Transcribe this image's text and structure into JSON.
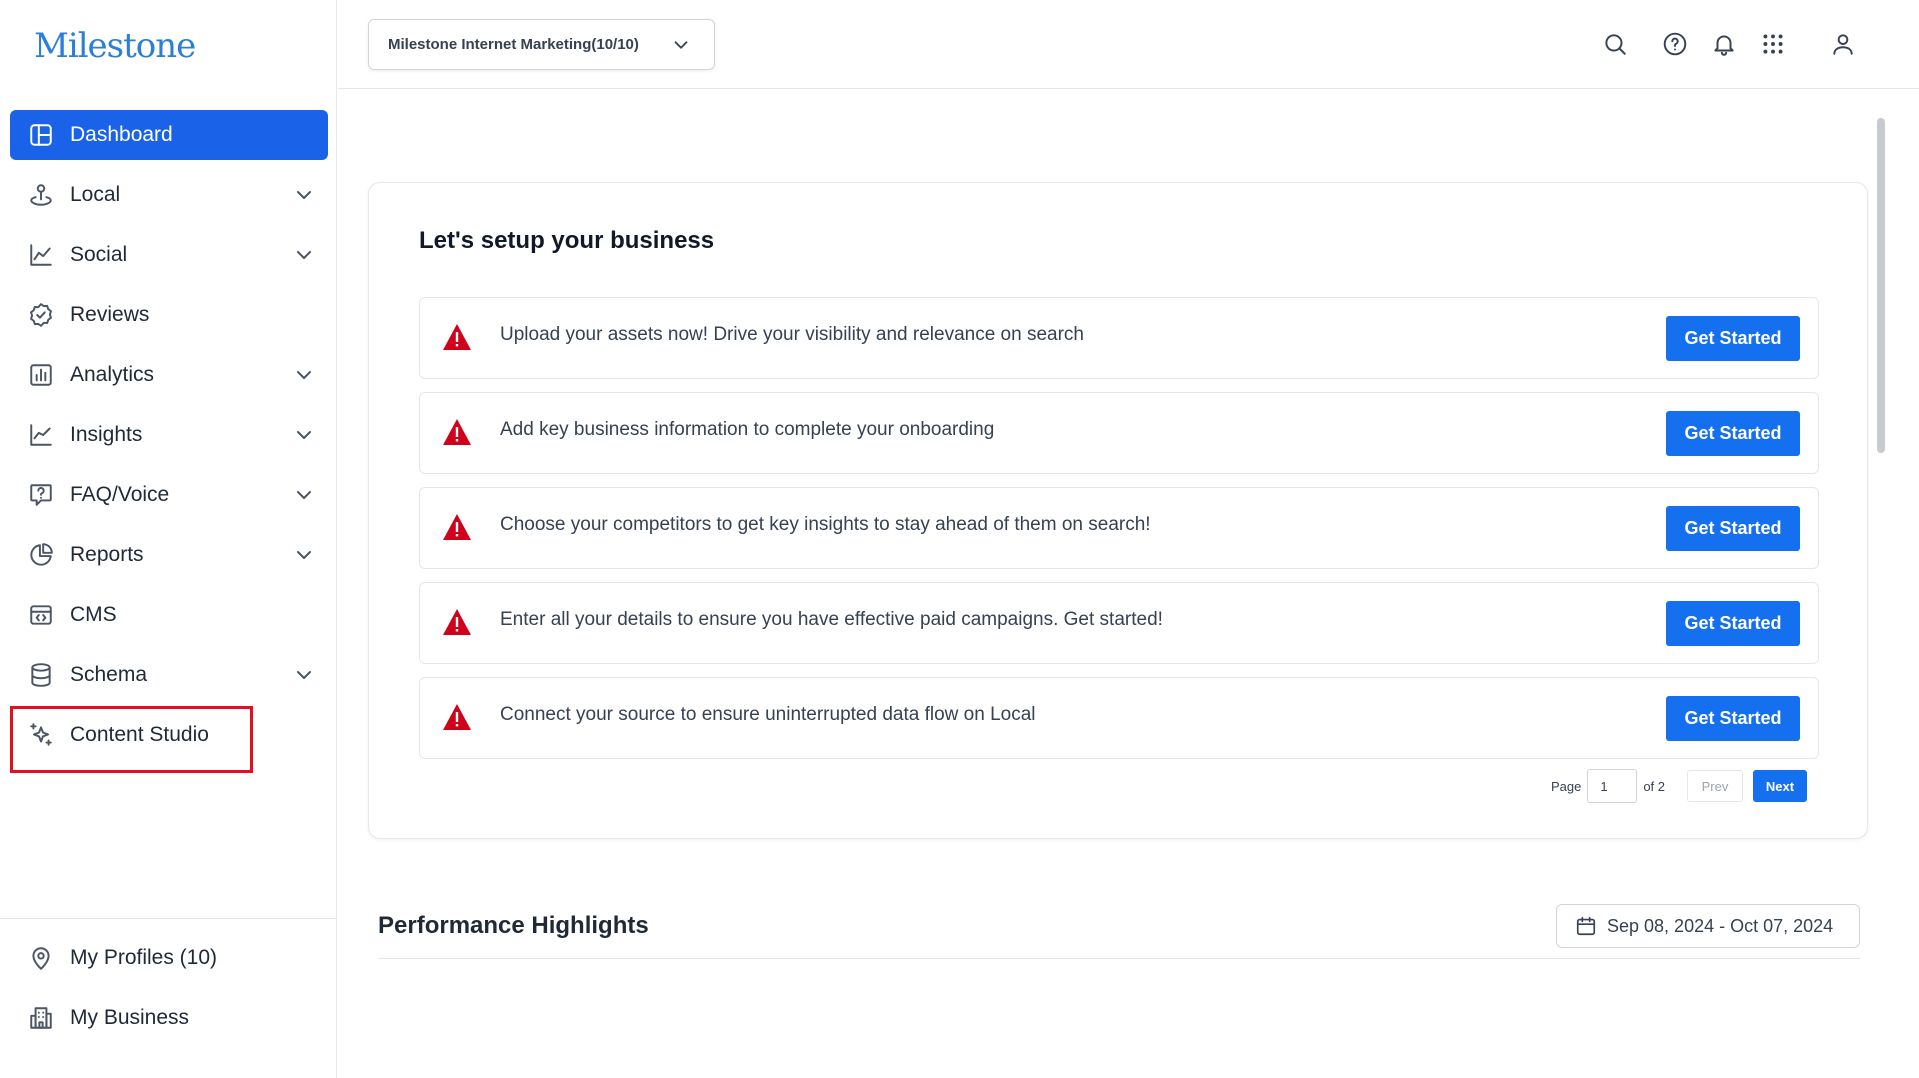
{
  "brand": {
    "logo_text": "Milestone",
    "logo_color": "#2b7fd6",
    "accent": "#1570ef"
  },
  "header": {
    "account_selector": "Milestone Internet Marketing(10/10)",
    "icons": [
      "search-icon",
      "help-icon",
      "bell-icon",
      "apps-grid-icon",
      "user-icon"
    ]
  },
  "sidebar": {
    "items": [
      {
        "label": "Dashboard",
        "icon": "dashboard-icon",
        "active": true,
        "expandable": false
      },
      {
        "label": "Local",
        "icon": "location-pin-icon",
        "expandable": true
      },
      {
        "label": "Social",
        "icon": "line-chart-icon",
        "expandable": true
      },
      {
        "label": "Reviews",
        "icon": "badge-check-icon",
        "expandable": false
      },
      {
        "label": "Analytics",
        "icon": "bar-chart-icon",
        "expandable": true
      },
      {
        "label": "Insights",
        "icon": "trend-chart-icon",
        "expandable": true
      },
      {
        "label": "FAQ/Voice",
        "icon": "faq-icon",
        "expandable": true
      },
      {
        "label": "Reports",
        "icon": "pie-chart-icon",
        "expandable": true
      },
      {
        "label": "CMS",
        "icon": "code-window-icon",
        "expandable": false
      },
      {
        "label": "Schema",
        "icon": "database-icon",
        "expandable": true
      },
      {
        "label": "Content Studio",
        "icon": "sparkles-icon",
        "expandable": false,
        "highlighted": true
      }
    ],
    "bottom": [
      {
        "label": "My Profiles (10)",
        "icon": "map-pin-icon"
      },
      {
        "label": "My Business",
        "icon": "building-icon"
      }
    ]
  },
  "setup": {
    "title": "Let's setup your business",
    "button_label": "Get Started",
    "tasks": [
      "Upload your assets now! Drive your visibility and relevance on search",
      "Add key business information to complete your onboarding",
      "Choose your competitors to get key insights to stay ahead of them on search!",
      "Enter all your details to ensure you have effective paid campaigns. Get started!",
      "Connect your source to ensure uninterrupted data flow on Local"
    ],
    "pager": {
      "page_label": "Page",
      "current": "1",
      "of_label": "of 2",
      "prev": "Prev",
      "next": "Next"
    }
  },
  "performance": {
    "title": "Performance Highlights",
    "date_range": "Sep 08, 2024 - Oct 07, 2024"
  },
  "colors": {
    "highlight_border": "#e0101f",
    "warning": "#d0021b",
    "active_nav": "#1a63e8"
  }
}
